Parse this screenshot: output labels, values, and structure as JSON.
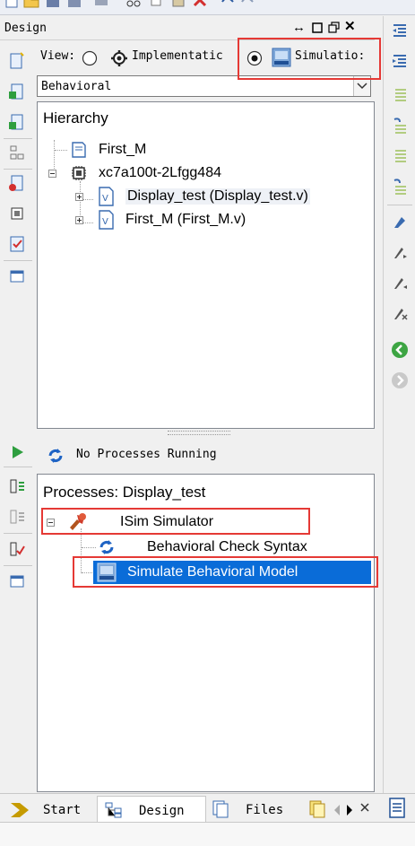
{
  "panel": {
    "title": "Design"
  },
  "view": {
    "label": "View:",
    "options": [
      {
        "label": "Implementatic",
        "selected": false
      },
      {
        "label": "Simulatio:",
        "selected": true
      }
    ]
  },
  "mode_select": {
    "value": "Behavioral"
  },
  "hierarchy": {
    "header": "Hierarchy",
    "items": [
      {
        "label": "First_M",
        "icon": "module-icon"
      },
      {
        "label": "xc7a100t-2Lfgg484",
        "icon": "chip-icon"
      },
      {
        "label": "Display_test (Display_test.v)",
        "icon": "verilog-file-icon",
        "selected": true
      },
      {
        "label": "First_M (First_M.v)",
        "icon": "verilog-file-icon"
      }
    ]
  },
  "processes": {
    "status": "No Processes Running",
    "header": "Processes: Display_test",
    "items": [
      {
        "label": "ISim Simulator",
        "icon": "isim-tools-icon"
      },
      {
        "label": "Behavioral Check Syntax",
        "icon": "refresh-icon"
      },
      {
        "label": "Simulate Behavioral Model",
        "icon": "isim-icon",
        "selected": true
      }
    ]
  },
  "tabs": [
    {
      "label": "Start"
    },
    {
      "label": "Design"
    },
    {
      "label": "Files"
    }
  ],
  "colors": {
    "highlight": "#0a6cd8",
    "red_annotation": "#e53935",
    "panel_bg": "#f0f0f0"
  }
}
